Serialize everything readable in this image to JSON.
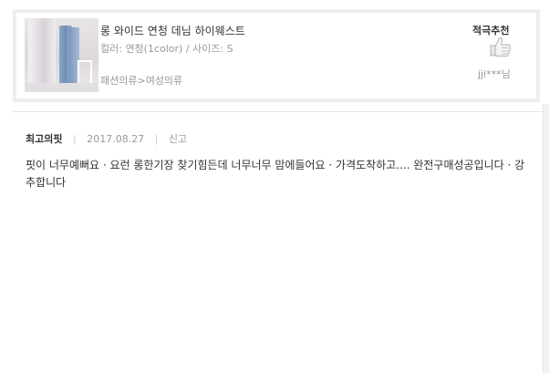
{
  "product": {
    "title": "롱 와이드 연청 데님 하이웨스트",
    "option": "컬러: 연청(1color) / 사이즈: S",
    "category": "패션의류>여성의류",
    "recommend_label": "적극추천",
    "recommend_icon": "thumbs-up-icon",
    "user": "jji***님"
  },
  "review": {
    "title": "최고의핏",
    "date": "2017.08.27",
    "report_label": "신고",
    "body": "핏이 너무예뻐요 · 요런 롱한기장 찾기힘든데 너무너무 맘에들어요 ·  가격도착하고.... 완전구매성공입니다 ·  강추합니다"
  }
}
